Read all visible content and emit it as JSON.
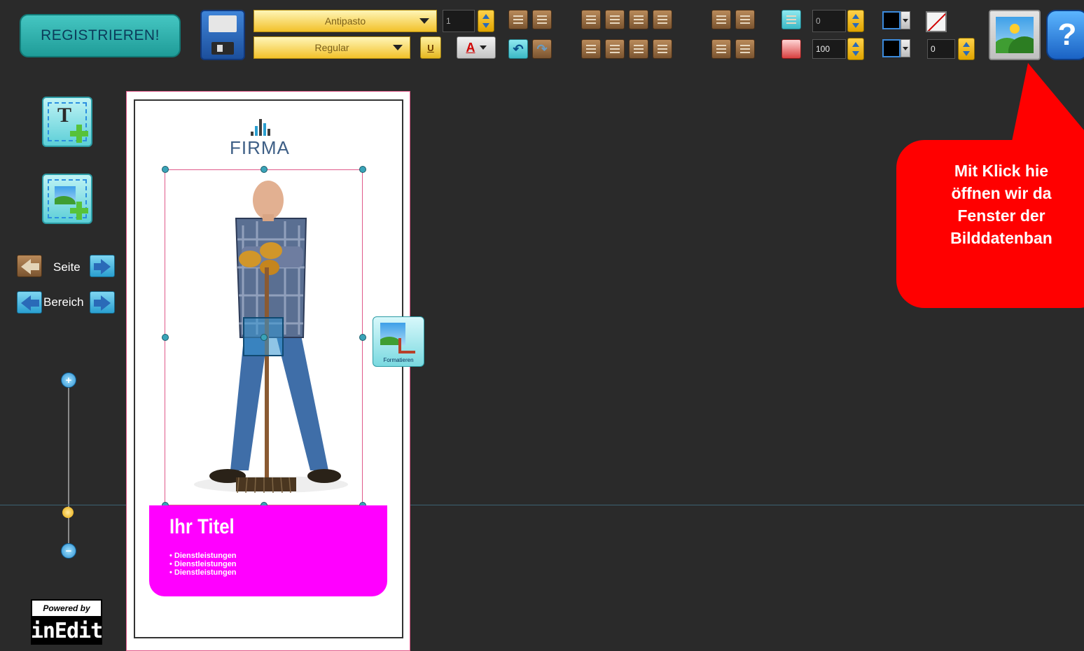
{
  "toolbar": {
    "register_label": "REGISTRIEREN!",
    "font_select": "Antipasto",
    "style_select": "Regular",
    "font_size": "1",
    "underline_label": "U",
    "font_color_label": "A",
    "spacing_value": "0",
    "opacity_value": "100",
    "border_width_value": "0"
  },
  "callout": {
    "lines": [
      "Mit Klick hie",
      "öffnen wir da",
      "Fenster der",
      "Bilddatenban"
    ]
  },
  "side": {
    "page_label": "Seite",
    "area_label": "Bereich",
    "powered_label": "Powered by",
    "logo_label": "inEdit"
  },
  "document": {
    "company": "FIRMA",
    "title": "Ihr Titel",
    "bullets": [
      "• Dienstleistungen",
      "• Dienstleistungen",
      "• Dienstleistungen"
    ],
    "format_label": "Formatieren"
  },
  "colors": {
    "accent_red": "#ff0000",
    "magenta": "#ff00ff",
    "teal": "#2fb3af"
  }
}
